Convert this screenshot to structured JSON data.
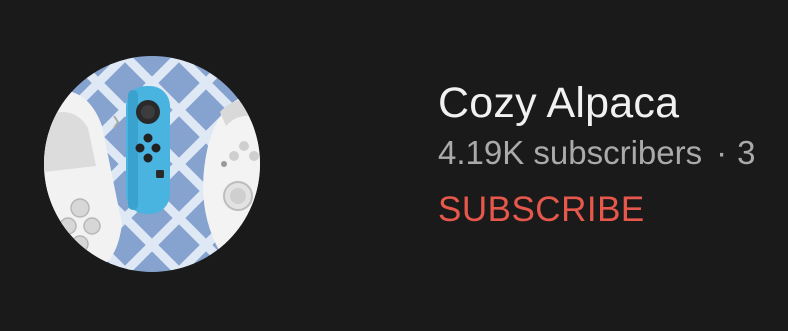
{
  "channel": {
    "name": "Cozy Alpaca",
    "subscribers": "4.19K subscribers",
    "separator": "·",
    "truncated_next": "3"
  },
  "actions": {
    "subscribe_label": "SUBSCRIBE"
  },
  "avatar": {
    "icon": "game-controllers-photo",
    "background_color": "#7f9bc8",
    "joycon_color": "#4ab4e0"
  },
  "colors": {
    "page_background": "#1a1a1a",
    "subscribe_accent": "#e6584b",
    "title_text": "#f1f1f1",
    "meta_text": "#aaaaaa"
  }
}
